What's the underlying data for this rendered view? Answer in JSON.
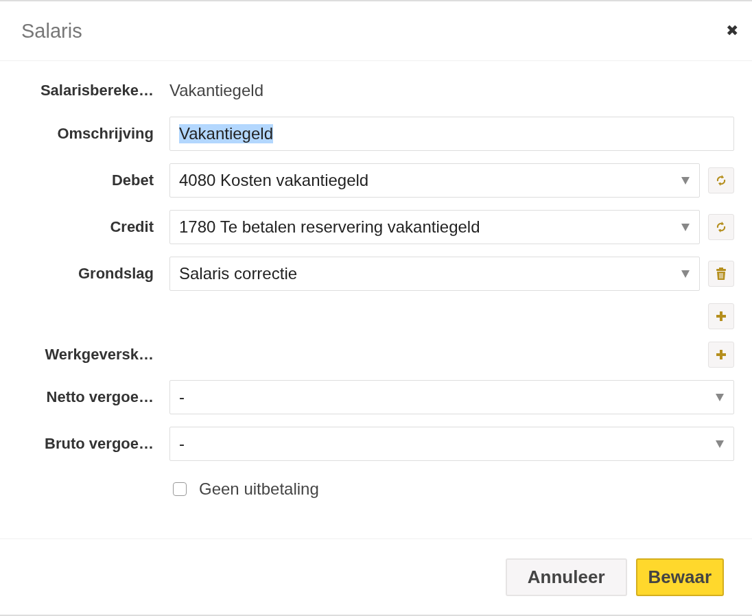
{
  "dialog": {
    "title": "Salaris",
    "close": "✖"
  },
  "rows": [
    {
      "kind": "static",
      "label": "Salarisbereke…",
      "value": "Vakantiegeld"
    },
    {
      "kind": "text",
      "label": "Omschrijving",
      "value": "Vakantiegeld",
      "text_selected": true
    },
    {
      "kind": "select",
      "label": "Debet",
      "value": "4080 Kosten vakantiegeld",
      "action": {
        "kind": "swap"
      }
    },
    {
      "kind": "select",
      "label": "Credit",
      "value": "1780 Te betalen reservering vakantiegeld",
      "action": {
        "kind": "swap"
      }
    },
    {
      "kind": "select",
      "label": "Grondslag",
      "value": "Salaris correctie",
      "action": {
        "kind": "delete"
      }
    },
    {
      "kind": "add"
    },
    {
      "kind": "add",
      "label": "Werkgeversk…"
    },
    {
      "kind": "select",
      "label": "Netto vergoe…",
      "value": "-"
    },
    {
      "kind": "select",
      "label": "Bruto vergoe…",
      "value": "-"
    },
    {
      "kind": "checkbox",
      "label": "Geen uitbetaling",
      "checked": false
    }
  ],
  "buttons": [
    {
      "label": "Annuleer",
      "kind": "secondary"
    },
    {
      "label": "Bewaar",
      "kind": "primary"
    }
  ]
}
